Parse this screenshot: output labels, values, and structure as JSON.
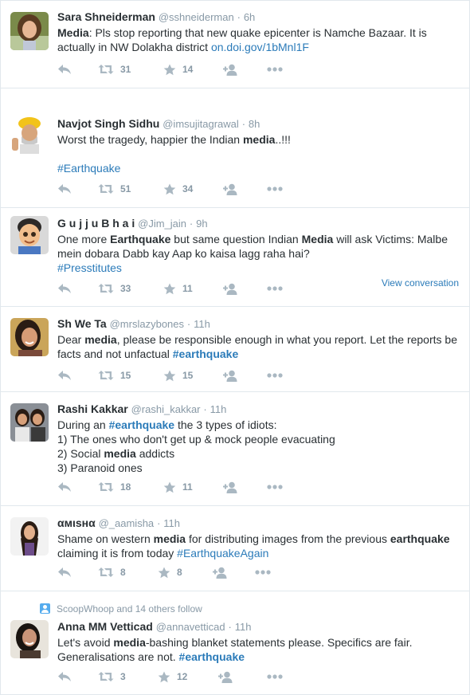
{
  "tweets": [
    {
      "fullname": "Sara Shneiderman",
      "username": "@sshneiderman",
      "time": "6h",
      "avatar": "woman-curly-hair-avatar",
      "text": [
        {
          "t": "Media",
          "style": "bold"
        },
        {
          "t": ": Pls stop reporting that new quake epicenter is Namche Bazaar. It is actually in NW Dolakha district "
        },
        {
          "t": "on.doi.gov/1bMnl1F",
          "style": "link"
        }
      ],
      "retweets": "31",
      "favorites": "14"
    },
    {
      "fullname": "Navjot Singh Sidhu",
      "username": "@imsujitagrawal",
      "time": "8h",
      "avatar": "man-turban-avatar",
      "text": [
        {
          "t": "Worst the tragedy, happier the Indian "
        },
        {
          "t": "media",
          "style": "bold"
        },
        {
          "t": "..!!!"
        },
        {
          "t": "\n\n",
          "style": "break"
        },
        {
          "t": "#Earthquake",
          "style": "tag"
        }
      ],
      "retweets": "51",
      "favorites": "34"
    },
    {
      "fullname": "G u j j u B h a i",
      "username": "@Jim_jain",
      "time": "9h",
      "avatar": "cartoon-boy-avatar",
      "text": [
        {
          "t": "One more "
        },
        {
          "t": "Earthquake",
          "style": "bold"
        },
        {
          "t": " but same question Indian "
        },
        {
          "t": "Media",
          "style": "bold"
        },
        {
          "t": " will ask Victims: Malbe mein dobara Dabb kay Aap ko kaisa lagg raha hai?"
        },
        {
          "t": "\n",
          "style": "break"
        },
        {
          "t": "#Presstitutes",
          "style": "tag"
        }
      ],
      "retweets": "33",
      "favorites": "11",
      "view_conversation": "View conversation"
    },
    {
      "fullname": "Sh We Ta",
      "username": "@mrslazybones",
      "time": "11h",
      "avatar": "woman-smiling-avatar",
      "text": [
        {
          "t": "Dear "
        },
        {
          "t": "media",
          "style": "bold"
        },
        {
          "t": ", please be responsible enough in what you report. Let the reports be facts and not unfactual "
        },
        {
          "t": "#earthquake",
          "style": "tagbold"
        }
      ],
      "retweets": "15",
      "favorites": "15"
    },
    {
      "fullname": "Rashi Kakkar",
      "username": "@rashi_kakkar",
      "time": "11h",
      "avatar": "two-women-avatar",
      "text": [
        {
          "t": "During an "
        },
        {
          "t": "#earthquake",
          "style": "tagbold"
        },
        {
          "t": " the 3 types of idiots:"
        },
        {
          "t": "\n",
          "style": "break"
        },
        {
          "t": "1) The ones who don't get up & mock people evacuating"
        },
        {
          "t": "\n",
          "style": "break"
        },
        {
          "t": "2) Social "
        },
        {
          "t": "media",
          "style": "bold"
        },
        {
          "t": " addicts"
        },
        {
          "t": "\n",
          "style": "break"
        },
        {
          "t": "3) Paranoid ones"
        }
      ],
      "retweets": "18",
      "favorites": "11"
    },
    {
      "fullname": "αмιѕнα",
      "username": "@_aamisha",
      "time": "11h",
      "avatar": "woman-long-hair-avatar",
      "text": [
        {
          "t": "Shame on western "
        },
        {
          "t": "media",
          "style": "bold"
        },
        {
          "t": " for distributing images from the previous "
        },
        {
          "t": "earthquake",
          "style": "bold"
        },
        {
          "t": " claiming it is from today "
        },
        {
          "t": "#EarthquakeAgain",
          "style": "tag"
        }
      ],
      "retweets": "8",
      "favorites": "8"
    },
    {
      "context": "ScoopWhoop and 14 others follow",
      "fullname": "Anna MM Vetticad",
      "username": "@annavetticad",
      "time": "11h",
      "avatar": "woman-dark-hair-avatar",
      "text": [
        {
          "t": "Let's avoid "
        },
        {
          "t": "media",
          "style": "bold"
        },
        {
          "t": "-bashing blanket statements please. Specifics are fair. Generalisations are not. "
        },
        {
          "t": "#earthquake",
          "style": "tagbold"
        }
      ],
      "retweets": "3",
      "favorites": "12"
    }
  ],
  "colors": {
    "name": "#292f33",
    "meta": "#8899a6",
    "link": "#2b7bb9",
    "divider": "#e1e8ed",
    "icon": "#aab8c2"
  },
  "separator": "·"
}
